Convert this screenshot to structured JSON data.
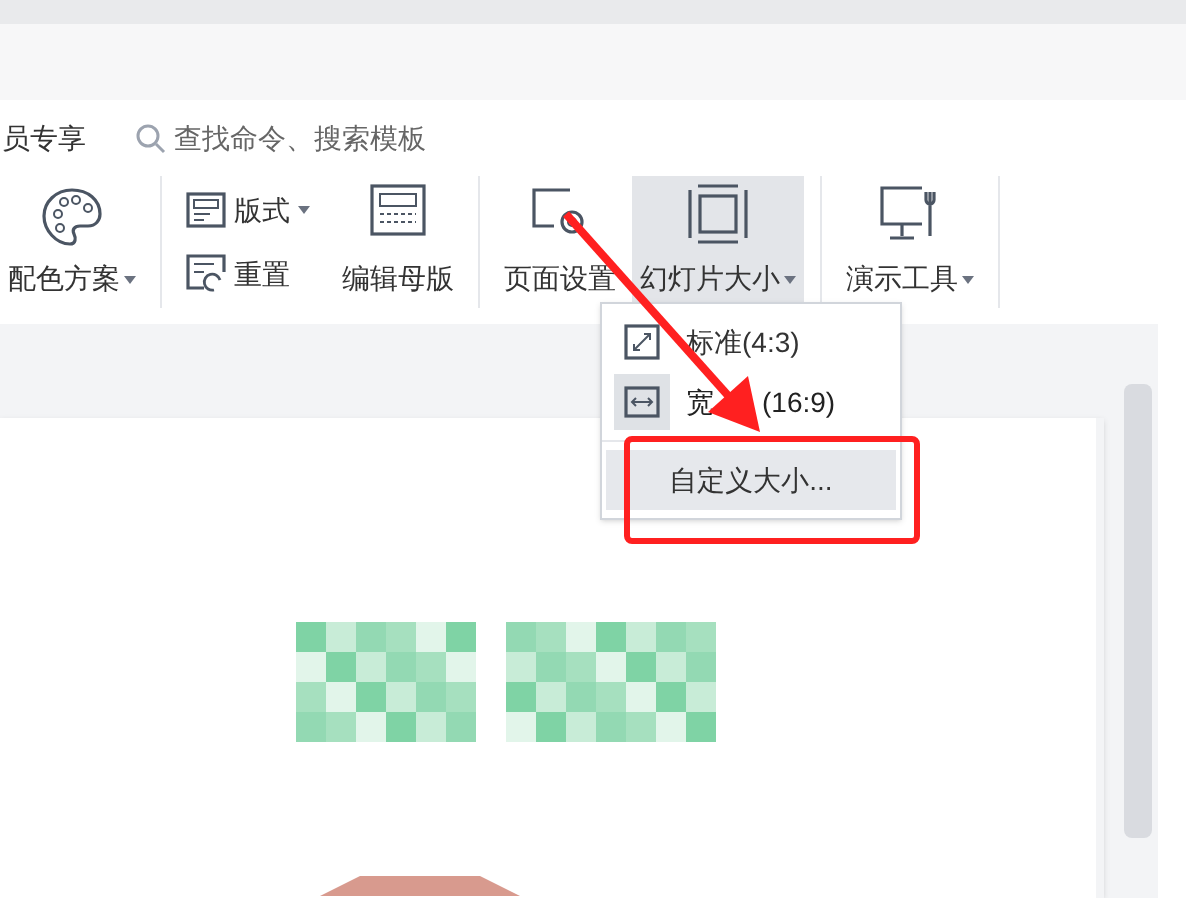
{
  "menu_bar": {
    "member_label": "员专享",
    "search": {
      "placeholder": "查找命令、搜索模板"
    }
  },
  "ribbon": {
    "groups": [
      {
        "kind": "large",
        "items": [
          {
            "kind": "palette",
            "label": "配色方案",
            "dropdown": true,
            "active": false
          }
        ]
      },
      {
        "kind": "mixed",
        "items": [
          {
            "kind": "layout",
            "label": "版式",
            "dropdown": true,
            "active": false
          },
          {
            "kind": "reset",
            "label": "重置",
            "dropdown": false,
            "active": false
          },
          {
            "kind": "master",
            "label": "编辑母版",
            "dropdown": false,
            "active": false
          }
        ]
      },
      {
        "kind": "large",
        "items": [
          {
            "kind": "page",
            "label": "页面设置",
            "dropdown": false,
            "active": false
          },
          {
            "kind": "size",
            "label": "幻灯片大小",
            "dropdown": true,
            "active": true
          }
        ]
      },
      {
        "kind": "large",
        "items": [
          {
            "kind": "tools",
            "label": "演示工具",
            "dropdown": true,
            "active": false
          }
        ]
      }
    ]
  },
  "dropdown": {
    "items": [
      {
        "kind": "standard",
        "label": "标准(4:3)",
        "selected": false,
        "hovered": false
      },
      {
        "kind": "wide",
        "label": "宽",
        "label_tail": "(16:9)",
        "selected": true,
        "hovered": false
      },
      {
        "kind": "custom",
        "label": "自定义大小...",
        "selected": false,
        "hovered": true
      }
    ]
  }
}
